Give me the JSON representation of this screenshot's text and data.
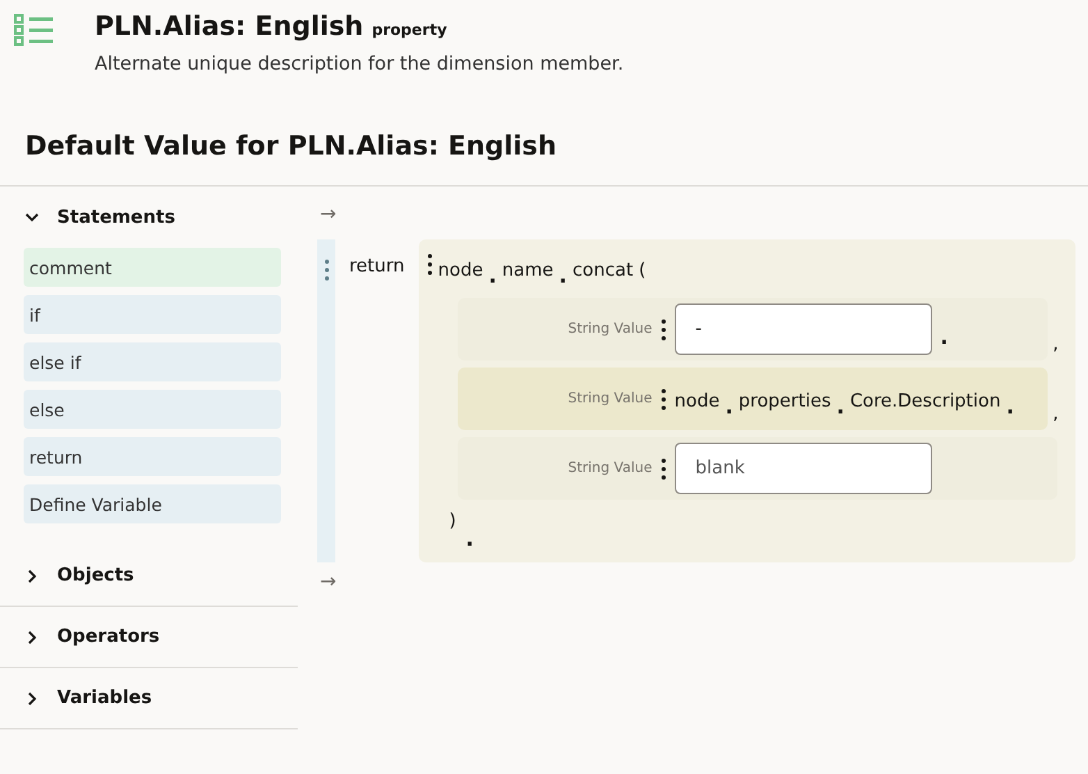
{
  "header": {
    "title": "PLN.Alias: English",
    "tag": "property",
    "description": "Alternate unique description for the dimension member."
  },
  "section_title": "Default Value for PLN.Alias: English",
  "palette": [
    {
      "label": "Statements",
      "expanded": true,
      "items": [
        {
          "label": "comment",
          "color": "#e3f3e6"
        },
        {
          "label": "if",
          "color": "#e6eff3"
        },
        {
          "label": "else if",
          "color": "#e6eff3"
        },
        {
          "label": "else",
          "color": "#e6eff3"
        },
        {
          "label": "return",
          "color": "#e6eff3"
        },
        {
          "label": "Define Variable",
          "color": "#e6eff3"
        }
      ]
    },
    {
      "label": "Objects",
      "expanded": false
    },
    {
      "label": "Operators",
      "expanded": false
    },
    {
      "label": "Variables",
      "expanded": false
    }
  ],
  "editor": {
    "arrows": [
      "→",
      "→"
    ],
    "keyword": "return",
    "chain": [
      {
        "kind": "word",
        "text": "node"
      },
      {
        "kind": "dot",
        "text": "."
      },
      {
        "kind": "word",
        "text": "name"
      },
      {
        "kind": "dot",
        "text": "."
      },
      {
        "kind": "word",
        "text": "concat ("
      }
    ],
    "args": [
      {
        "kind": "input",
        "label": "String Value",
        "value": "-",
        "trailing": ".",
        "separator": ",",
        "highlighted": false
      },
      {
        "kind": "chain",
        "label": "String Value",
        "tokens": [
          {
            "kind": "word",
            "text": "node"
          },
          {
            "kind": "dot",
            "text": "."
          },
          {
            "kind": "word",
            "text": "properties"
          },
          {
            "kind": "dot",
            "text": "."
          },
          {
            "kind": "word",
            "text": "Core.Description"
          },
          {
            "kind": "dot",
            "text": "."
          }
        ],
        "separator": ",",
        "highlighted": true
      },
      {
        "kind": "input",
        "label": "String Value",
        "placeholder": "blank",
        "highlighted": false
      }
    ],
    "close": ")",
    "end_dot": "."
  }
}
